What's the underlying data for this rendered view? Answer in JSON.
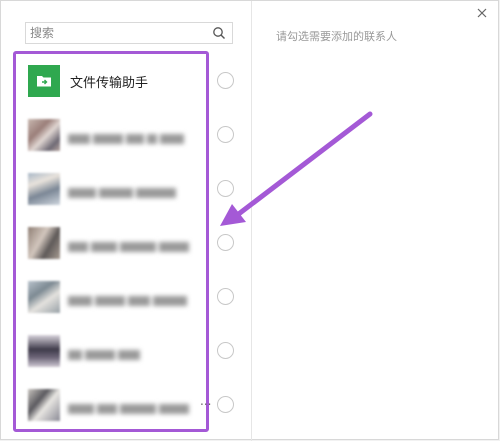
{
  "search": {
    "placeholder": "搜索"
  },
  "right_pane": {
    "hint": "请勾选需要添加的联系人"
  },
  "contacts": [
    {
      "name": "文件传输助手",
      "avatar": "file-transfer-icon",
      "blurred": false
    },
    {
      "name": "",
      "blurred": true
    },
    {
      "name": "",
      "blurred": true
    },
    {
      "name": "",
      "blurred": true
    },
    {
      "name": "",
      "blurred": true
    },
    {
      "name": "",
      "blurred": true
    },
    {
      "name": "",
      "blurred": true,
      "ellipsis": "..."
    }
  ],
  "colors": {
    "highlight_border": "#a459d6",
    "arrow": "#a459d6",
    "file_transfer_bg": "#2fa84f"
  }
}
